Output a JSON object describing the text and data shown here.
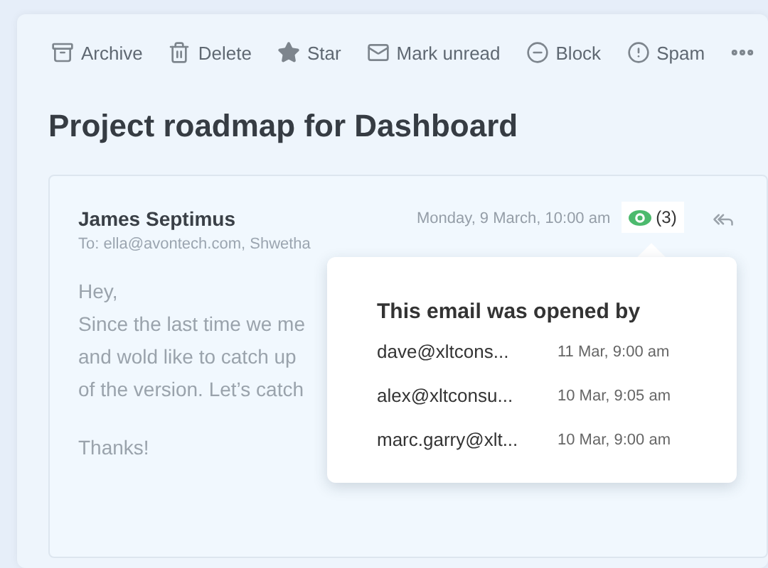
{
  "toolbar": [
    {
      "label": "Archive",
      "kind": "archive"
    },
    {
      "label": "Delete",
      "kind": "delete"
    },
    {
      "label": "Star",
      "kind": "star"
    },
    {
      "label": "Mark unread",
      "kind": "mail"
    },
    {
      "label": "Block",
      "kind": "block"
    },
    {
      "label": "Spam",
      "kind": "spam"
    },
    {
      "kind": "more"
    }
  ],
  "subject": "Project roadmap for Dashboard",
  "message": {
    "sender": "James Septimus",
    "to": "To: ella@avontech.com, Shwetha",
    "date": "Monday, 9 March, 10:00 am",
    "opens": "(3)",
    "body": [
      "Hey,",
      "Since the last time we me",
      "and wold like to catch up",
      "of the version. Let’s catch"
    ],
    "closing": "Thanks!"
  },
  "popover": {
    "title": "This email was opened by",
    "rows": [
      {
        "email": "dave@xltcons...",
        "time": "11 Mar, 9:00 am"
      },
      {
        "email": "alex@xltconsu...",
        "time": "10 Mar, 9:05 am"
      },
      {
        "email": "marc.garry@xlt...",
        "time": "10 Mar, 9:00 am"
      }
    ]
  }
}
